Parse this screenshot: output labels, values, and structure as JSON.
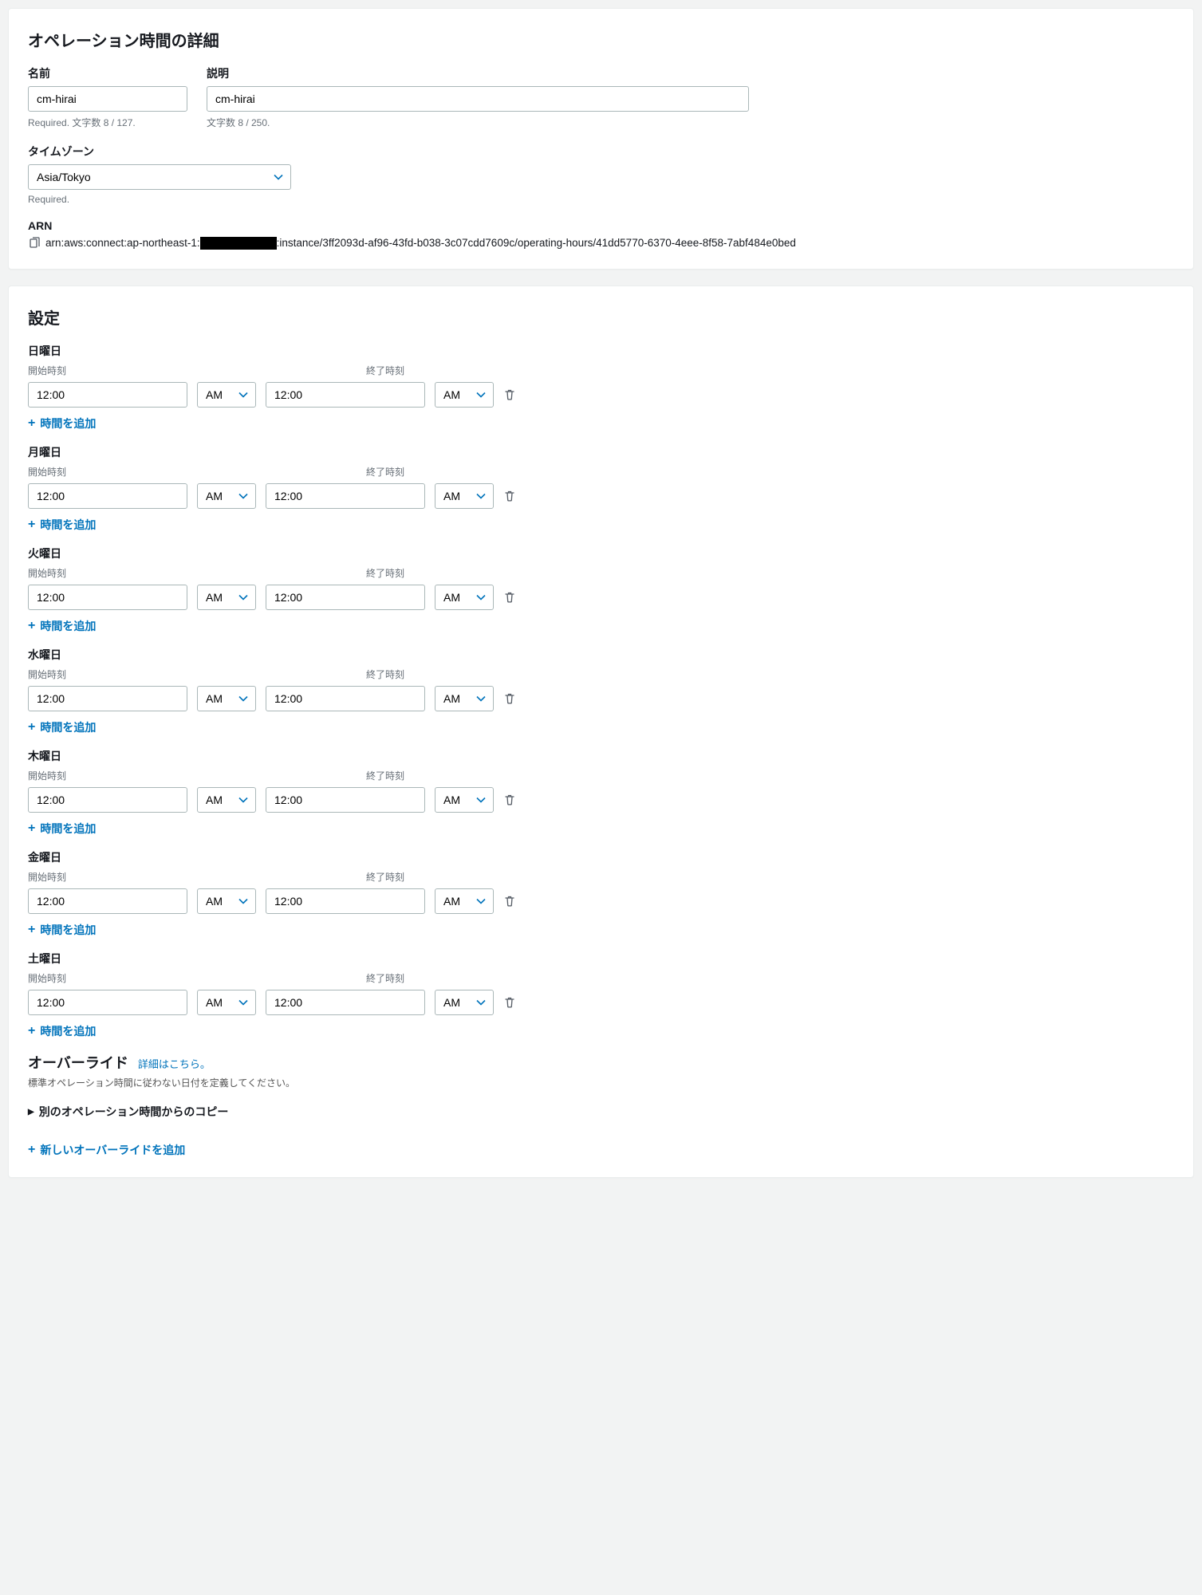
{
  "details": {
    "heading": "オペレーション時間の詳細",
    "name_label": "名前",
    "name_value": "cm-hirai",
    "name_help": "Required. 文字数 8 / 127.",
    "desc_label": "説明",
    "desc_value": "cm-hirai",
    "desc_help": "文字数 8 / 250.",
    "tz_label": "タイムゾーン",
    "tz_value": "Asia/Tokyo",
    "tz_help": "Required.",
    "arn_label": "ARN",
    "arn_prefix": "arn:aws:connect:ap-northeast-1:",
    "arn_suffix": ":instance/3ff2093d-af96-43fd-b038-3c07cdd7609c/operating-hours/41dd5770-6370-4eee-8f58-7abf484e0bed"
  },
  "settings": {
    "heading": "設定",
    "start_label": "開始時刻",
    "end_label": "終了時刻",
    "add_time": "時間を追加",
    "days": [
      {
        "name": "日曜日",
        "start_time": "12:00",
        "start_ampm": "AM",
        "end_time": "12:00",
        "end_ampm": "AM"
      },
      {
        "name": "月曜日",
        "start_time": "12:00",
        "start_ampm": "AM",
        "end_time": "12:00",
        "end_ampm": "AM"
      },
      {
        "name": "火曜日",
        "start_time": "12:00",
        "start_ampm": "AM",
        "end_time": "12:00",
        "end_ampm": "AM"
      },
      {
        "name": "水曜日",
        "start_time": "12:00",
        "start_ampm": "AM",
        "end_time": "12:00",
        "end_ampm": "AM"
      },
      {
        "name": "木曜日",
        "start_time": "12:00",
        "start_ampm": "AM",
        "end_time": "12:00",
        "end_ampm": "AM"
      },
      {
        "name": "金曜日",
        "start_time": "12:00",
        "start_ampm": "AM",
        "end_time": "12:00",
        "end_ampm": "AM"
      },
      {
        "name": "土曜日",
        "start_time": "12:00",
        "start_ampm": "AM",
        "end_time": "12:00",
        "end_ampm": "AM"
      }
    ]
  },
  "override": {
    "heading": "オーバーライド",
    "details_link": "詳細はこちら。",
    "desc": "標準オペレーション時間に従わない日付を定義してください。",
    "copy_from": "別のオペレーション時間からのコピー",
    "add_new": "新しいオーバーライドを追加"
  }
}
